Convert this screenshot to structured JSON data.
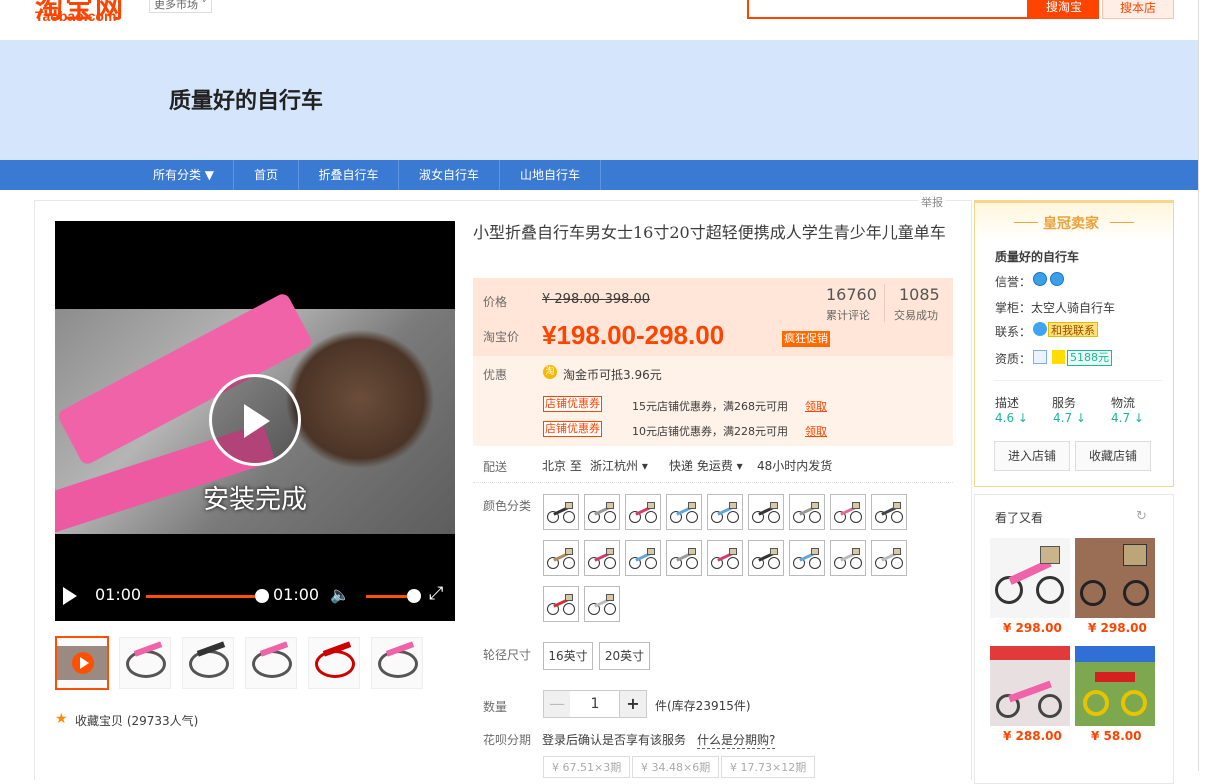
{
  "header": {
    "logo_cn": "淘宝网",
    "logo_en": "Taobao.com",
    "more_market": "更多市场",
    "search_taobao_btn": "搜淘宝",
    "search_shop_btn": "搜本店"
  },
  "shop": {
    "title": "质量好的自行车"
  },
  "nav": {
    "items": [
      {
        "label": "所有分类 ▼"
      },
      {
        "label": "首页"
      },
      {
        "label": "折叠自行车"
      },
      {
        "label": "淑女自行车"
      },
      {
        "label": "山地自行车"
      }
    ]
  },
  "report": "举报",
  "video": {
    "caption": "安装完成",
    "current_time": "01:00",
    "total_time": "01:00"
  },
  "gallery": {
    "favorite": "收藏宝贝 (29733人气)"
  },
  "product": {
    "title": "小型折叠自行车男女士16寸20寸超轻便携成人学生青少年儿童单车",
    "price_label": "价格",
    "orig_price": "¥ 298.00-398.00",
    "tb_price_label": "淘宝价",
    "tb_price": "¥198.00-298.00",
    "promo_badge": "疯狂促销",
    "review_count": "16760",
    "review_label": "累计评论",
    "deal_count": "1085",
    "deal_label": "交易成功",
    "discount_label": "优惠",
    "coin_icon": "淘",
    "coin_text": "淘金币可抵3.96元",
    "coupons": [
      {
        "tag": "店铺优惠券",
        "text": "15元店铺优惠券，满268元可用",
        "action": "领取"
      },
      {
        "tag": "店铺优惠券",
        "text": "10元店铺优惠券，满228元可用",
        "action": "领取"
      }
    ],
    "shipping_label": "配送",
    "ship_from": "北京 至",
    "ship_to": "浙江杭州 ▾",
    "ship_method": "快递 免运费 ▾",
    "ship_time": "48小时内发货",
    "color_label": "颜色分类",
    "wheel_label": "轮径尺寸",
    "sizes": [
      "16英寸",
      "20英寸"
    ],
    "qty_label": "数量",
    "qty_minus": "—",
    "qty_value": "1",
    "qty_plus": "+",
    "qty_unit": "件(库存23915件)",
    "huabei_label": "花呗分期",
    "huabei_text": "登录后确认是否享有该服务",
    "huabei_link": "什么是分期购?",
    "installments": [
      "¥ 67.51×3期",
      "¥ 34.48×6期",
      "¥ 17.73×12期"
    ]
  },
  "seller": {
    "crown": "皇冠卖家",
    "name": "质量好的自行车",
    "credit_label": "信誉：",
    "keeper_label": "掌柜：",
    "keeper_name": "太空人骑自行车",
    "contact_label": "联系：",
    "contact_btn": "和我联系",
    "qual_label": "资质：",
    "deposit": "5188元",
    "scores": [
      {
        "label": "描述",
        "value": "4.6 ↓"
      },
      {
        "label": "服务",
        "value": "4.7 ↓"
      },
      {
        "label": "物流",
        "value": "4.7 ↓"
      }
    ],
    "enter_shop": "进入店铺",
    "fav_shop": "收藏店铺"
  },
  "recommend": {
    "title": "看了又看",
    "refresh_icon": "refresh-icon",
    "items": [
      {
        "price": "¥ 298.00"
      },
      {
        "price": "¥ 298.00"
      },
      {
        "price": "¥ 288.00"
      },
      {
        "price": "¥ 58.00"
      }
    ]
  },
  "colors": {
    "accent": "#ff4400",
    "nav_bg": "#3b7ad2",
    "banner_bg": "#d5e5fb"
  }
}
